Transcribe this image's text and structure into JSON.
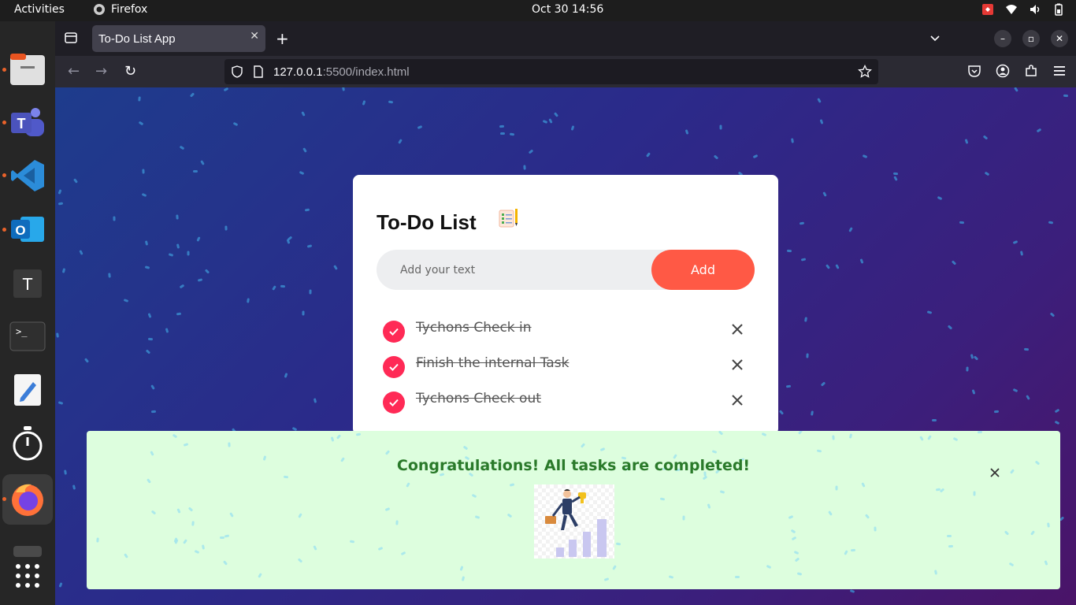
{
  "topbar": {
    "activities": "Activities",
    "app_name": "Firefox",
    "clock": "Oct 30  14:56"
  },
  "dock": {
    "items": [
      "files-icon",
      "teams-icon",
      "vscode-icon",
      "outlook-icon",
      "text-editor-icon",
      "terminal-icon",
      "notes-icon",
      "timer-icon",
      "firefox-icon",
      "apps-grid-icon"
    ]
  },
  "browser": {
    "tab_title": "To-Do List App",
    "url_host": "127.0.0.1",
    "url_rest": ":5500/index.html"
  },
  "app": {
    "title": "To-Do List",
    "input_placeholder": "Add your text",
    "add_label": "Add",
    "tasks": [
      {
        "text": "Tychons Check in",
        "checked": true
      },
      {
        "text": "Finish the internal Task",
        "checked": true
      },
      {
        "text": "Tychons Check out",
        "checked": true
      }
    ]
  },
  "congrats": {
    "message": "Congratulations! All tasks are completed!"
  },
  "colors": {
    "accent": "#ff5945",
    "check": "#ff2a56",
    "congrats_bg": "#ddfede",
    "congrats_text": "#2a7a2a"
  }
}
